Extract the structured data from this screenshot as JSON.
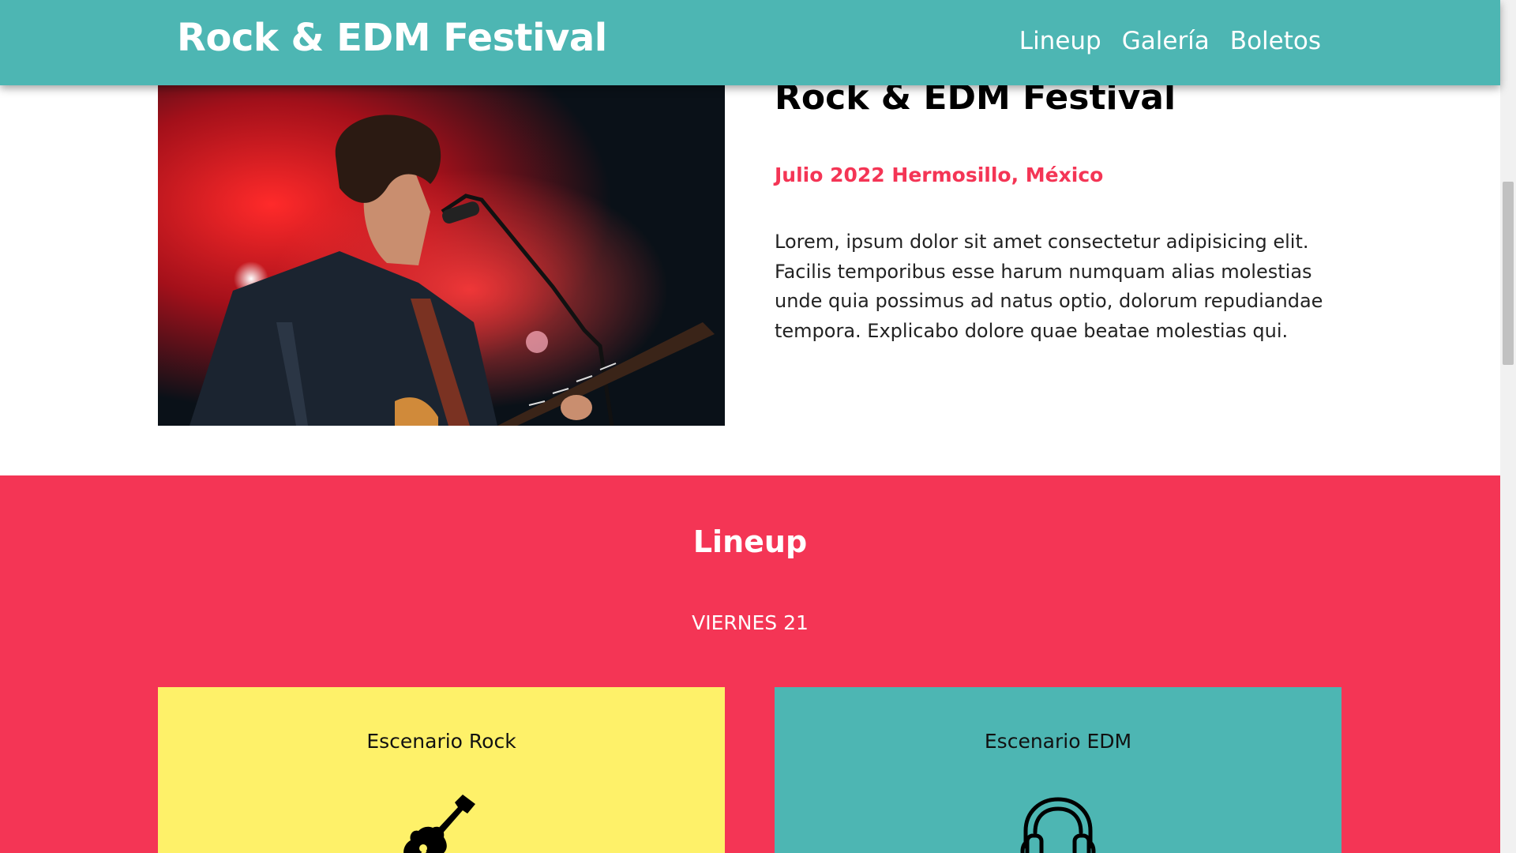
{
  "header": {
    "logo": "Rock & EDM Festival",
    "nav": [
      "Lineup",
      "Galería",
      "Boletos"
    ]
  },
  "hero": {
    "image_alt": "singer-guitarist-photo",
    "title": "Rock & EDM Festival",
    "date_location": "Julio 2022 Hermosillo, México",
    "description": "Lorem, ipsum dolor sit amet consectetur adipisicing elit. Facilis temporibus esse harum numquam alias molestias unde quia possimus ad natus optio, dolorum repudiandae tempora. Explicabo dolore quae beatae molestias qui."
  },
  "lineup": {
    "heading": "Lineup",
    "day": "VIERNES 21",
    "stages": [
      {
        "name": "Escenario Rock",
        "icon": "guitar-icon",
        "color": "#fef169"
      },
      {
        "name": "Escenario EDM",
        "icon": "headphones-icon",
        "color": "#4db6b3"
      }
    ]
  },
  "colors": {
    "header": "#4db6b3",
    "accent": "#f43555",
    "rock_card": "#fef169",
    "edm_card": "#4db6b3"
  }
}
